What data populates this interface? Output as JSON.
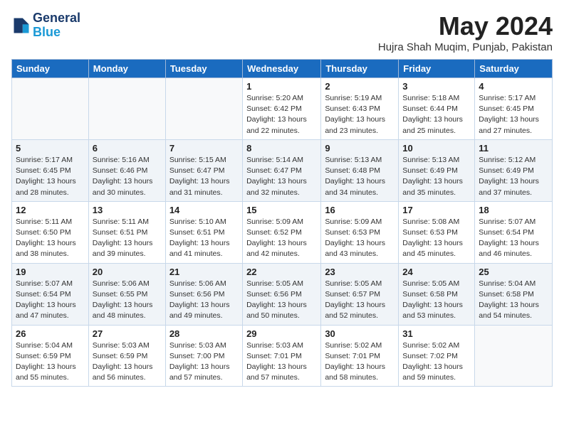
{
  "header": {
    "logo_line1": "General",
    "logo_line2": "Blue",
    "month_year": "May 2024",
    "location": "Hujra Shah Muqim, Punjab, Pakistan"
  },
  "days_of_week": [
    "Sunday",
    "Monday",
    "Tuesday",
    "Wednesday",
    "Thursday",
    "Friday",
    "Saturday"
  ],
  "weeks": [
    [
      {
        "day": "",
        "info": ""
      },
      {
        "day": "",
        "info": ""
      },
      {
        "day": "",
        "info": ""
      },
      {
        "day": "1",
        "info": "Sunrise: 5:20 AM\nSunset: 6:42 PM\nDaylight: 13 hours\nand 22 minutes."
      },
      {
        "day": "2",
        "info": "Sunrise: 5:19 AM\nSunset: 6:43 PM\nDaylight: 13 hours\nand 23 minutes."
      },
      {
        "day": "3",
        "info": "Sunrise: 5:18 AM\nSunset: 6:44 PM\nDaylight: 13 hours\nand 25 minutes."
      },
      {
        "day": "4",
        "info": "Sunrise: 5:17 AM\nSunset: 6:45 PM\nDaylight: 13 hours\nand 27 minutes."
      }
    ],
    [
      {
        "day": "5",
        "info": "Sunrise: 5:17 AM\nSunset: 6:45 PM\nDaylight: 13 hours\nand 28 minutes."
      },
      {
        "day": "6",
        "info": "Sunrise: 5:16 AM\nSunset: 6:46 PM\nDaylight: 13 hours\nand 30 minutes."
      },
      {
        "day": "7",
        "info": "Sunrise: 5:15 AM\nSunset: 6:47 PM\nDaylight: 13 hours\nand 31 minutes."
      },
      {
        "day": "8",
        "info": "Sunrise: 5:14 AM\nSunset: 6:47 PM\nDaylight: 13 hours\nand 32 minutes."
      },
      {
        "day": "9",
        "info": "Sunrise: 5:13 AM\nSunset: 6:48 PM\nDaylight: 13 hours\nand 34 minutes."
      },
      {
        "day": "10",
        "info": "Sunrise: 5:13 AM\nSunset: 6:49 PM\nDaylight: 13 hours\nand 35 minutes."
      },
      {
        "day": "11",
        "info": "Sunrise: 5:12 AM\nSunset: 6:49 PM\nDaylight: 13 hours\nand 37 minutes."
      }
    ],
    [
      {
        "day": "12",
        "info": "Sunrise: 5:11 AM\nSunset: 6:50 PM\nDaylight: 13 hours\nand 38 minutes."
      },
      {
        "day": "13",
        "info": "Sunrise: 5:11 AM\nSunset: 6:51 PM\nDaylight: 13 hours\nand 39 minutes."
      },
      {
        "day": "14",
        "info": "Sunrise: 5:10 AM\nSunset: 6:51 PM\nDaylight: 13 hours\nand 41 minutes."
      },
      {
        "day": "15",
        "info": "Sunrise: 5:09 AM\nSunset: 6:52 PM\nDaylight: 13 hours\nand 42 minutes."
      },
      {
        "day": "16",
        "info": "Sunrise: 5:09 AM\nSunset: 6:53 PM\nDaylight: 13 hours\nand 43 minutes."
      },
      {
        "day": "17",
        "info": "Sunrise: 5:08 AM\nSunset: 6:53 PM\nDaylight: 13 hours\nand 45 minutes."
      },
      {
        "day": "18",
        "info": "Sunrise: 5:07 AM\nSunset: 6:54 PM\nDaylight: 13 hours\nand 46 minutes."
      }
    ],
    [
      {
        "day": "19",
        "info": "Sunrise: 5:07 AM\nSunset: 6:54 PM\nDaylight: 13 hours\nand 47 minutes."
      },
      {
        "day": "20",
        "info": "Sunrise: 5:06 AM\nSunset: 6:55 PM\nDaylight: 13 hours\nand 48 minutes."
      },
      {
        "day": "21",
        "info": "Sunrise: 5:06 AM\nSunset: 6:56 PM\nDaylight: 13 hours\nand 49 minutes."
      },
      {
        "day": "22",
        "info": "Sunrise: 5:05 AM\nSunset: 6:56 PM\nDaylight: 13 hours\nand 50 minutes."
      },
      {
        "day": "23",
        "info": "Sunrise: 5:05 AM\nSunset: 6:57 PM\nDaylight: 13 hours\nand 52 minutes."
      },
      {
        "day": "24",
        "info": "Sunrise: 5:05 AM\nSunset: 6:58 PM\nDaylight: 13 hours\nand 53 minutes."
      },
      {
        "day": "25",
        "info": "Sunrise: 5:04 AM\nSunset: 6:58 PM\nDaylight: 13 hours\nand 54 minutes."
      }
    ],
    [
      {
        "day": "26",
        "info": "Sunrise: 5:04 AM\nSunset: 6:59 PM\nDaylight: 13 hours\nand 55 minutes."
      },
      {
        "day": "27",
        "info": "Sunrise: 5:03 AM\nSunset: 6:59 PM\nDaylight: 13 hours\nand 56 minutes."
      },
      {
        "day": "28",
        "info": "Sunrise: 5:03 AM\nSunset: 7:00 PM\nDaylight: 13 hours\nand 57 minutes."
      },
      {
        "day": "29",
        "info": "Sunrise: 5:03 AM\nSunset: 7:01 PM\nDaylight: 13 hours\nand 57 minutes."
      },
      {
        "day": "30",
        "info": "Sunrise: 5:02 AM\nSunset: 7:01 PM\nDaylight: 13 hours\nand 58 minutes."
      },
      {
        "day": "31",
        "info": "Sunrise: 5:02 AM\nSunset: 7:02 PM\nDaylight: 13 hours\nand 59 minutes."
      },
      {
        "day": "",
        "info": ""
      }
    ]
  ]
}
